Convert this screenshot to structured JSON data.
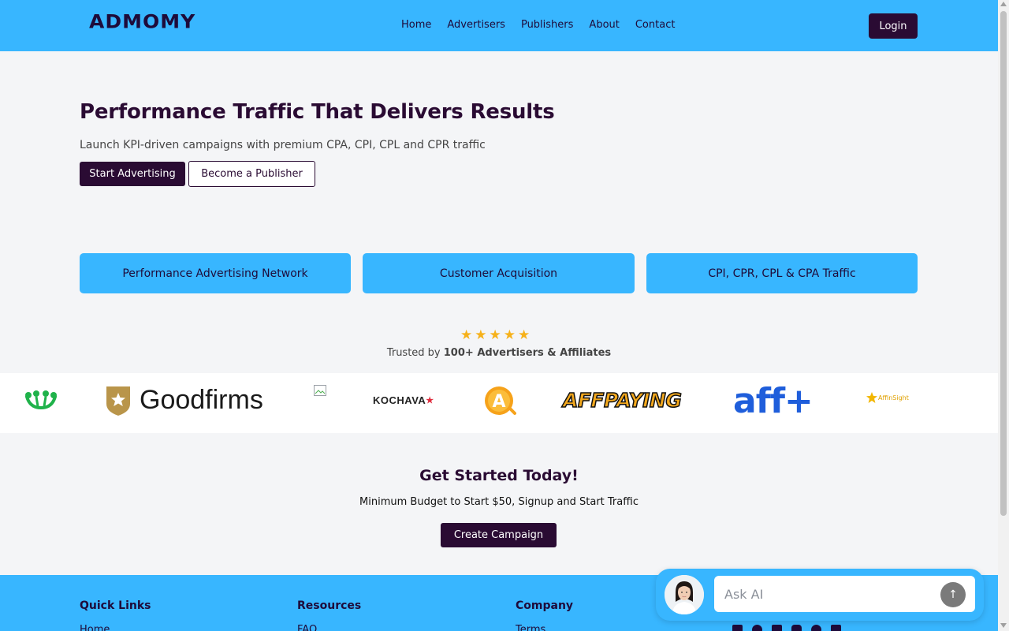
{
  "header": {
    "logo_text": "ADMOMY",
    "nav": [
      "Home",
      "Advertisers",
      "Publishers",
      "About",
      "Contact"
    ],
    "login_label": "Login"
  },
  "hero": {
    "title": "Performance Traffic That Delivers Results",
    "subtitle": "Launch KPI-driven campaigns with premium CPA, CPI, CPL and CPR traffic",
    "primary_cta": "Start Advertising",
    "secondary_cta": "Become a Publisher"
  },
  "cards": [
    "Performance Advertising Network",
    "Customer Acquisition",
    "CPI, CPR, CPL & CPA Traffic"
  ],
  "trust": {
    "rating_stars": 5,
    "text_prefix": "Trusted by ",
    "text_bold": "100+ Advertisers & Affiliates"
  },
  "partner_logos": {
    "goodfirms": "Goodfirms",
    "kochava": "KOCHAVA",
    "affpaying": "AFFPAYING",
    "affplus": "aff+",
    "affinsight": "AffinSight"
  },
  "get_started": {
    "title": "Get Started Today!",
    "subtitle": "Minimum Budget to Start $50, Signup and Start Traffic",
    "cta": "Create Campaign"
  },
  "footer": {
    "columns": [
      {
        "title": "Quick Links",
        "first_link": "Home"
      },
      {
        "title": "Resources",
        "first_link": "FAQ"
      },
      {
        "title": "Company",
        "first_link": "Terms"
      }
    ],
    "social_icons": [
      "linkedin-icon",
      "facebook-icon",
      "twitter-icon",
      "instagram-icon",
      "pinterest-icon",
      "email-icon"
    ]
  },
  "ai_widget": {
    "placeholder": "Ask AI",
    "send_icon": "arrow-up-icon"
  },
  "colors": {
    "brand_blue": "#38b6ff",
    "brand_dark": "#2a0b33",
    "star_gold": "#f6b11a"
  }
}
